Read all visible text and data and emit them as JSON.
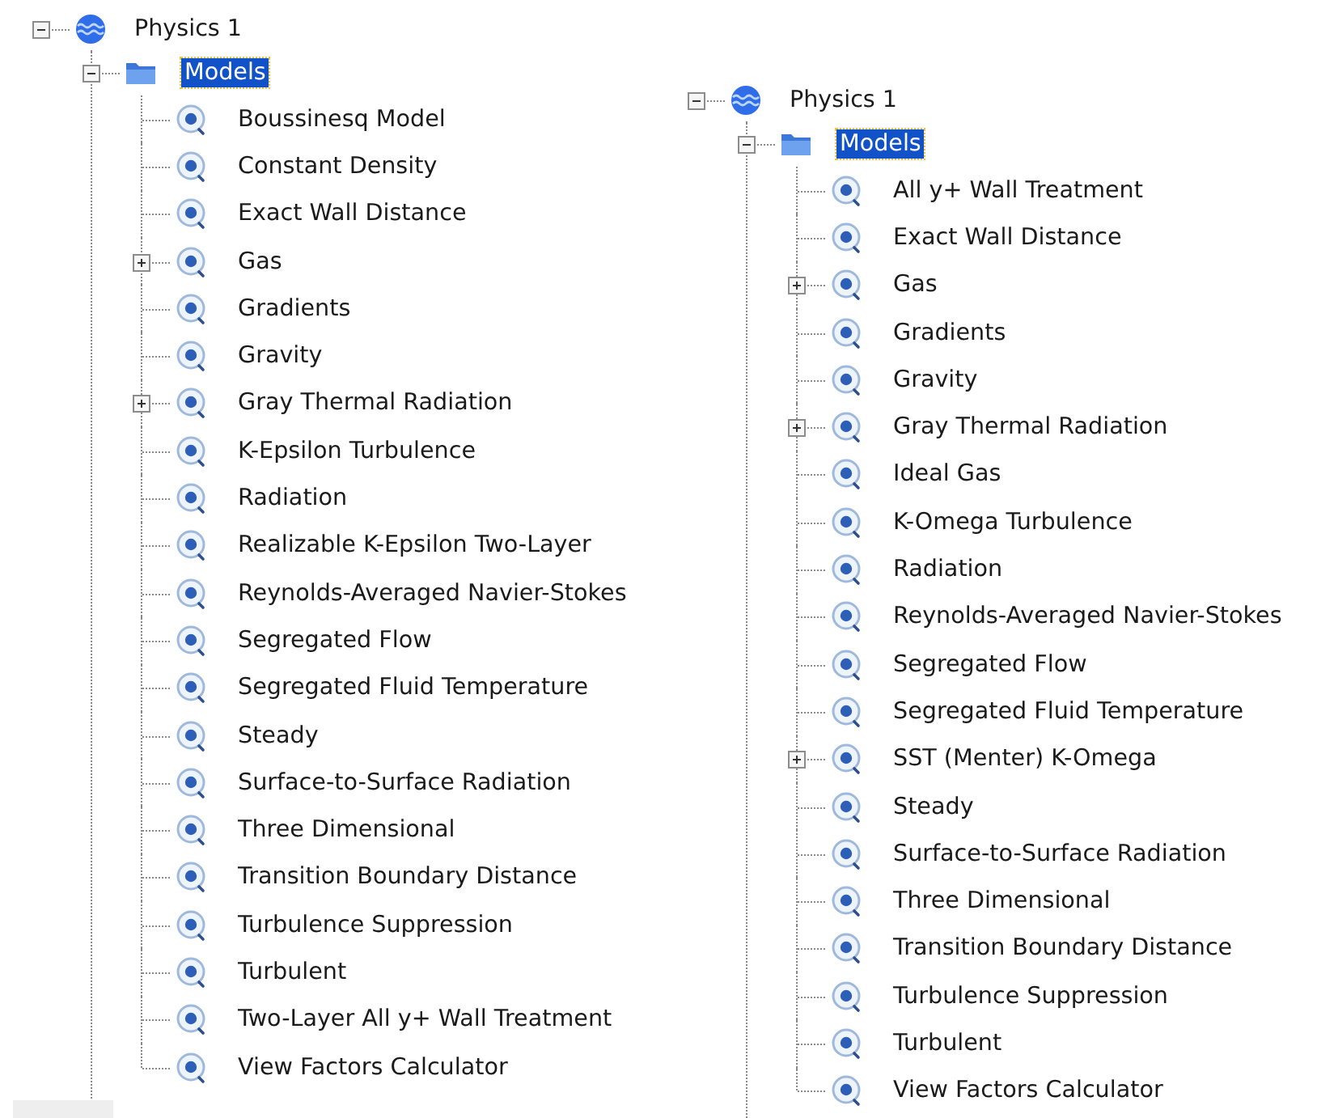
{
  "trees": [
    {
      "label": "Physics 1",
      "kind": "physics",
      "expandable": true,
      "expanded": true,
      "selected": false,
      "children": [
        {
          "label": "Models",
          "kind": "folder",
          "expandable": true,
          "expanded": true,
          "selected": true,
          "children": [
            {
              "label": "Boussinesq Model",
              "kind": "model",
              "expandable": false,
              "selected": false
            },
            {
              "label": "Constant Density",
              "kind": "model",
              "expandable": false,
              "selected": false
            },
            {
              "label": "Exact Wall Distance",
              "kind": "model",
              "expandable": false,
              "selected": false
            },
            {
              "label": "Gas",
              "kind": "model",
              "expandable": true,
              "expanded": false,
              "selected": false
            },
            {
              "label": "Gradients",
              "kind": "model",
              "expandable": false,
              "selected": false
            },
            {
              "label": "Gravity",
              "kind": "model",
              "expandable": false,
              "selected": false
            },
            {
              "label": "Gray Thermal Radiation",
              "kind": "model",
              "expandable": true,
              "expanded": false,
              "selected": false
            },
            {
              "label": "K-Epsilon Turbulence",
              "kind": "model",
              "expandable": false,
              "selected": false
            },
            {
              "label": "Radiation",
              "kind": "model",
              "expandable": false,
              "selected": false
            },
            {
              "label": "Realizable K-Epsilon Two-Layer",
              "kind": "model",
              "expandable": false,
              "selected": false
            },
            {
              "label": "Reynolds-Averaged Navier-Stokes",
              "kind": "model",
              "expandable": false,
              "selected": false
            },
            {
              "label": "Segregated Flow",
              "kind": "model",
              "expandable": false,
              "selected": false
            },
            {
              "label": "Segregated Fluid Temperature",
              "kind": "model",
              "expandable": false,
              "selected": false
            },
            {
              "label": "Steady",
              "kind": "model",
              "expandable": false,
              "selected": false
            },
            {
              "label": "Surface-to-Surface Radiation",
              "kind": "model",
              "expandable": false,
              "selected": false
            },
            {
              "label": "Three Dimensional",
              "kind": "model",
              "expandable": false,
              "selected": false
            },
            {
              "label": "Transition Boundary Distance",
              "kind": "model",
              "expandable": false,
              "selected": false
            },
            {
              "label": "Turbulence Suppression",
              "kind": "model",
              "expandable": false,
              "selected": false
            },
            {
              "label": "Turbulent",
              "kind": "model",
              "expandable": false,
              "selected": false
            },
            {
              "label": "Two-Layer All y+ Wall Treatment",
              "kind": "model",
              "expandable": false,
              "selected": false
            },
            {
              "label": "View Factors Calculator",
              "kind": "model",
              "expandable": false,
              "selected": false
            }
          ]
        }
      ]
    },
    {
      "label": "Physics 1",
      "kind": "physics",
      "expandable": true,
      "expanded": true,
      "selected": false,
      "children": [
        {
          "label": "Models",
          "kind": "folder",
          "expandable": true,
          "expanded": true,
          "selected": true,
          "children": [
            {
              "label": "All y+ Wall Treatment",
              "kind": "model",
              "expandable": false,
              "selected": false
            },
            {
              "label": "Exact Wall Distance",
              "kind": "model",
              "expandable": false,
              "selected": false
            },
            {
              "label": "Gas",
              "kind": "model",
              "expandable": true,
              "expanded": false,
              "selected": false
            },
            {
              "label": "Gradients",
              "kind": "model",
              "expandable": false,
              "selected": false
            },
            {
              "label": "Gravity",
              "kind": "model",
              "expandable": false,
              "selected": false
            },
            {
              "label": "Gray Thermal Radiation",
              "kind": "model",
              "expandable": true,
              "expanded": false,
              "selected": false
            },
            {
              "label": "Ideal Gas",
              "kind": "model",
              "expandable": false,
              "selected": false
            },
            {
              "label": "K-Omega Turbulence",
              "kind": "model",
              "expandable": false,
              "selected": false
            },
            {
              "label": "Radiation",
              "kind": "model",
              "expandable": false,
              "selected": false
            },
            {
              "label": "Reynolds-Averaged Navier-Stokes",
              "kind": "model",
              "expandable": false,
              "selected": false
            },
            {
              "label": "Segregated Flow",
              "kind": "model",
              "expandable": false,
              "selected": false
            },
            {
              "label": "Segregated Fluid Temperature",
              "kind": "model",
              "expandable": false,
              "selected": false
            },
            {
              "label": "SST (Menter) K-Omega",
              "kind": "model",
              "expandable": true,
              "expanded": false,
              "selected": false
            },
            {
              "label": "Steady",
              "kind": "model",
              "expandable": false,
              "selected": false
            },
            {
              "label": "Surface-to-Surface Radiation",
              "kind": "model",
              "expandable": false,
              "selected": false
            },
            {
              "label": "Three Dimensional",
              "kind": "model",
              "expandable": false,
              "selected": false
            },
            {
              "label": "Transition Boundary Distance",
              "kind": "model",
              "expandable": false,
              "selected": false
            },
            {
              "label": "Turbulence Suppression",
              "kind": "model",
              "expandable": false,
              "selected": false
            },
            {
              "label": "Turbulent",
              "kind": "model",
              "expandable": false,
              "selected": false
            },
            {
              "label": "View Factors Calculator",
              "kind": "model",
              "expandable": false,
              "selected": false
            }
          ]
        }
      ]
    }
  ]
}
